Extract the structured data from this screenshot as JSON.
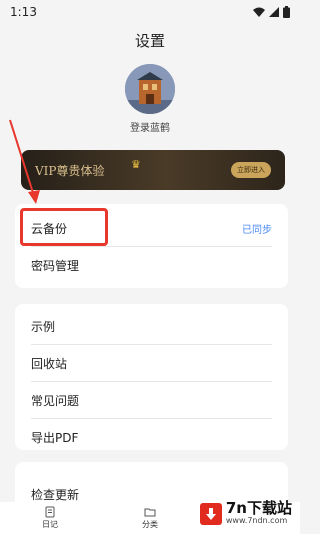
{
  "status_bar": {
    "time": "1:13"
  },
  "header": {
    "title": "设置"
  },
  "profile": {
    "login_label": "登录蓝鹤"
  },
  "vip": {
    "label": "VIP尊贵体验",
    "button": "立即进入"
  },
  "card1": {
    "items": [
      {
        "label": "云备份",
        "value": "已同步"
      },
      {
        "label": "密码管理",
        "value": ""
      }
    ]
  },
  "card2": {
    "items": [
      {
        "label": "示例"
      },
      {
        "label": "回收站"
      },
      {
        "label": "常见问题"
      },
      {
        "label": "导出PDF"
      }
    ]
  },
  "card3": {
    "items": [
      {
        "label": "检查更新"
      }
    ]
  },
  "bottom_nav": {
    "items": [
      {
        "label": "日记"
      },
      {
        "label": "分类"
      }
    ]
  },
  "watermark": {
    "brand": "7n下载站",
    "url": "www.7ndn.com"
  },
  "colors": {
    "accent": "#4a8af4",
    "highlight": "#e8372c",
    "vip_gold": "#d9c08e"
  },
  "icons": [
    "wifi-icon",
    "signal-icon",
    "battery-icon",
    "crown-icon",
    "diary-icon",
    "folder-icon",
    "download-arrow-icon"
  ]
}
